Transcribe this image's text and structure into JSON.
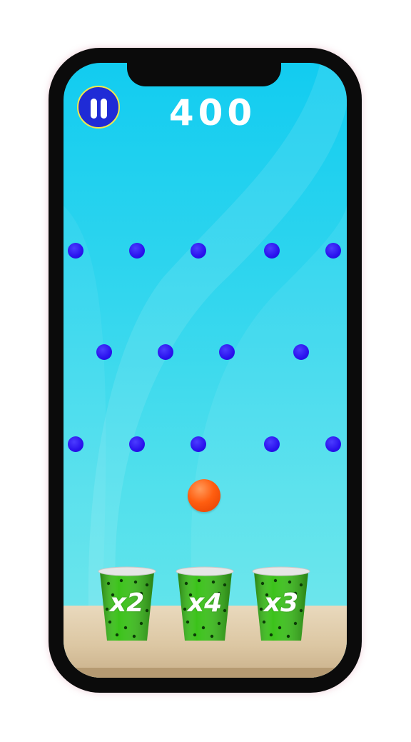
{
  "hud": {
    "score": "400",
    "pause_icon": "pause-icon"
  },
  "colors": {
    "background": "#12ccf0",
    "peg": "#2a12ee",
    "ball": "#ff5e10",
    "cup": "#3bc21a",
    "pause_ring": "#f2e84a"
  },
  "cups": [
    {
      "label": "x2"
    },
    {
      "label": "x4"
    },
    {
      "label": "x3"
    }
  ]
}
